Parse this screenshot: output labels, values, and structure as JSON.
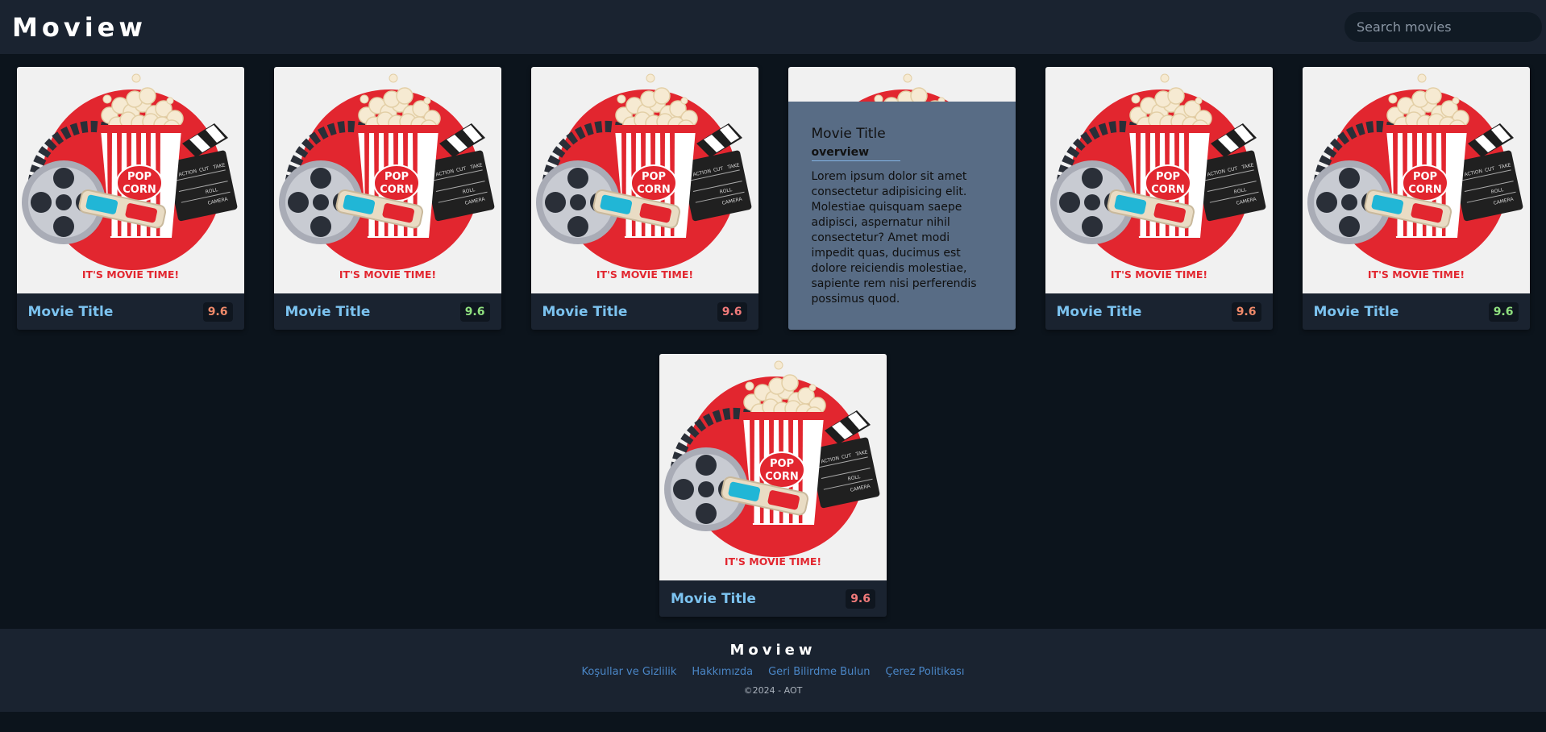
{
  "header": {
    "brand": "Moview",
    "search_placeholder": "Search movies"
  },
  "poster": {
    "text": "IT'S MOVIE TIME!",
    "popcorn_text_1": "POP",
    "popcorn_text_2": "CORN",
    "clapper_label_1": "ACTION",
    "clapper_label_2": "CUT",
    "clapper_label_3": "TAKE",
    "clapper_label_4": "ROLL",
    "clapper_label_5": "CAMERA"
  },
  "movies": [
    {
      "title": "Movie Title",
      "rating": "9.6",
      "rating_color": "#f08a6a"
    },
    {
      "title": "Movie Title",
      "rating": "9.6",
      "rating_color": "#8fe07f"
    },
    {
      "title": "Movie Title",
      "rating": "9.6",
      "rating_color": "#f07a7a"
    },
    {
      "title": "Movie Title",
      "overview_label": "overview",
      "overview": "Lorem ipsum dolor sit amet consectetur adipisicing elit. Molestiae quisquam saepe adipisci, aspernatur nihil consectetur? Amet modi impedit quas, ducimus est dolore reiciendis molestiae, sapiente rem nisi perferendis possimus quod."
    },
    {
      "title": "Movie Title",
      "rating": "9.6",
      "rating_color": "#f08a6a"
    },
    {
      "title": "Movie Title",
      "rating": "9.6",
      "rating_color": "#8fe07f"
    },
    {
      "title": "Movie Title",
      "rating": "9.6",
      "rating_color": "#f07a7a"
    }
  ],
  "footer": {
    "brand": "Moview",
    "links": [
      "Koşullar ve Gizlilik",
      "Hakkımızda",
      "Geri Bilirdme Bulun",
      "Çerez Politikası"
    ],
    "copyright": "©2024 - AOT"
  }
}
